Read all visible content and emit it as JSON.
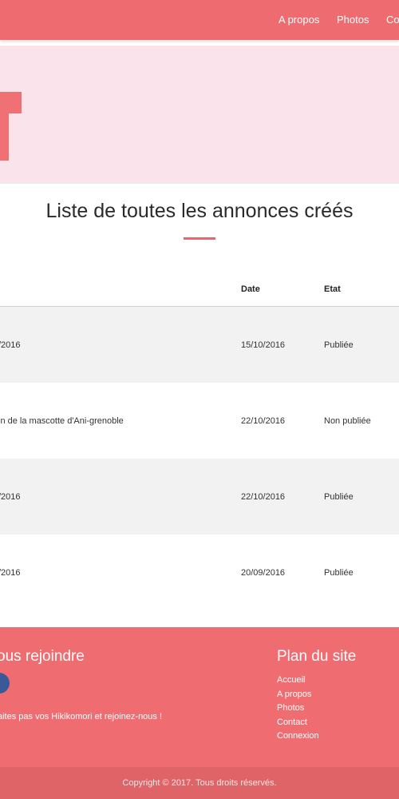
{
  "nav": {
    "items": [
      "A propos",
      "Photos",
      "Co"
    ]
  },
  "main": {
    "title": "Liste de toutes les annonces créés"
  },
  "table": {
    "headers": {
      "date": "Date",
      "etat": "Etat"
    },
    "rows": [
      {
        "title": "/2016",
        "date": "15/10/2016",
        "etat": "Publiée"
      },
      {
        "title": "in de la mascotte d'Ani-grenoble",
        "date": "22/10/2016",
        "etat": "Non publiée"
      },
      {
        "title": "/2016",
        "date": "22/10/2016",
        "etat": "Publiée"
      },
      {
        "title": "/2016",
        "date": "20/09/2016",
        "etat": "Publiée"
      }
    ]
  },
  "footer": {
    "join_heading": "ous rejoindre",
    "join_text": "aites pas vos Hikikomori et rejoinez-nous !",
    "sitemap_heading": "Plan du site",
    "sitemap": [
      "Accueil",
      "A propos",
      "Photos",
      "Contact",
      "Connexion"
    ],
    "copyright": "Copyright © 2017. Tous droits réservés."
  },
  "colors": {
    "primary": "#ee6c70",
    "hero_bg": "#fae3ea",
    "footer_bottom": "#de6468",
    "facebook": "#3b5998"
  }
}
